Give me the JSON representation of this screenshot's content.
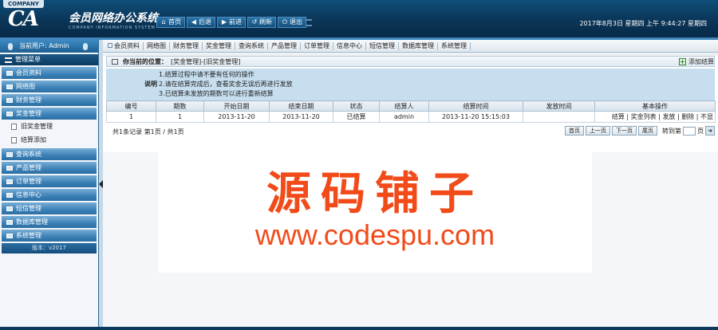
{
  "header": {
    "company_tab": "COMPANY",
    "logo": "CA",
    "system_name": "会员网络办公系统",
    "system_sub": "COMPANY INFORMATION SYSTEM",
    "nav": [
      {
        "label": "首页",
        "icon": "home-icon",
        "glyph": "⌂"
      },
      {
        "label": "后退",
        "icon": "back-icon",
        "glyph": "◀"
      },
      {
        "label": "前进",
        "icon": "forward-icon",
        "glyph": "▶"
      },
      {
        "label": "刷新",
        "icon": "refresh-icon",
        "glyph": "↺"
      },
      {
        "label": "退出",
        "icon": "exit-icon",
        "glyph": "⏻"
      }
    ],
    "datetime": "2017年8月3日 星期四 上午 9:44:27 星期四"
  },
  "sidebar": {
    "current_user": "当前用户: Admin",
    "menu_title": "管理菜单",
    "items": [
      {
        "label": "会员资料"
      },
      {
        "label": "网络图"
      },
      {
        "label": "财务管理"
      },
      {
        "label": "奖金管理"
      }
    ],
    "sub_items": [
      {
        "label": "旧奖金管理"
      },
      {
        "label": "结算添加"
      }
    ],
    "items_after": [
      {
        "label": "查询系统"
      },
      {
        "label": "产品管理"
      },
      {
        "label": "订单管理"
      },
      {
        "label": "信息中心"
      },
      {
        "label": "短信管理"
      },
      {
        "label": "数据库管理"
      },
      {
        "label": "系统管理"
      }
    ],
    "version": "版本：v2017"
  },
  "tabs": [
    "会员资料",
    "网络图",
    "财务管理",
    "奖金管理",
    "查询系统",
    "产品管理",
    "订单管理",
    "信息中心",
    "短信管理",
    "数据库管理",
    "系统管理"
  ],
  "location": {
    "label": "你当前的位置：",
    "path": "[奖金管理]-[旧奖金管理]",
    "add_link": "添加结算"
  },
  "notes": {
    "label": "说明",
    "lines": [
      "1.结算过程中请不要有任何的操作",
      "2.请在结算完成后，查看奖金无误后再进行发放",
      "3.已结算未发放的期数可以进行重新结算"
    ]
  },
  "table": {
    "headers": [
      "编号",
      "期数",
      "开始日期",
      "结束日期",
      "状态",
      "结算人",
      "结算时间",
      "发放时间",
      "基本操作"
    ],
    "rows": [
      {
        "cells": [
          "1",
          "1",
          "2013-11-20",
          "2013-11-20",
          "已结算",
          "admin",
          "2013-11-20 15:15:03",
          ""
        ],
        "ops": [
          "结算",
          "奖金列表",
          "发放",
          "删除",
          "不显"
        ]
      }
    ]
  },
  "pager": {
    "records": "共1条记录  第1页 / 共1页",
    "buttons": [
      "首页",
      "上一页",
      "下一页",
      "尾页"
    ],
    "goto_label": "转到第",
    "goto_unit": "页",
    "go": "➜"
  },
  "watermark": {
    "cn": "源码铺子",
    "url": "www.codespu.com"
  }
}
